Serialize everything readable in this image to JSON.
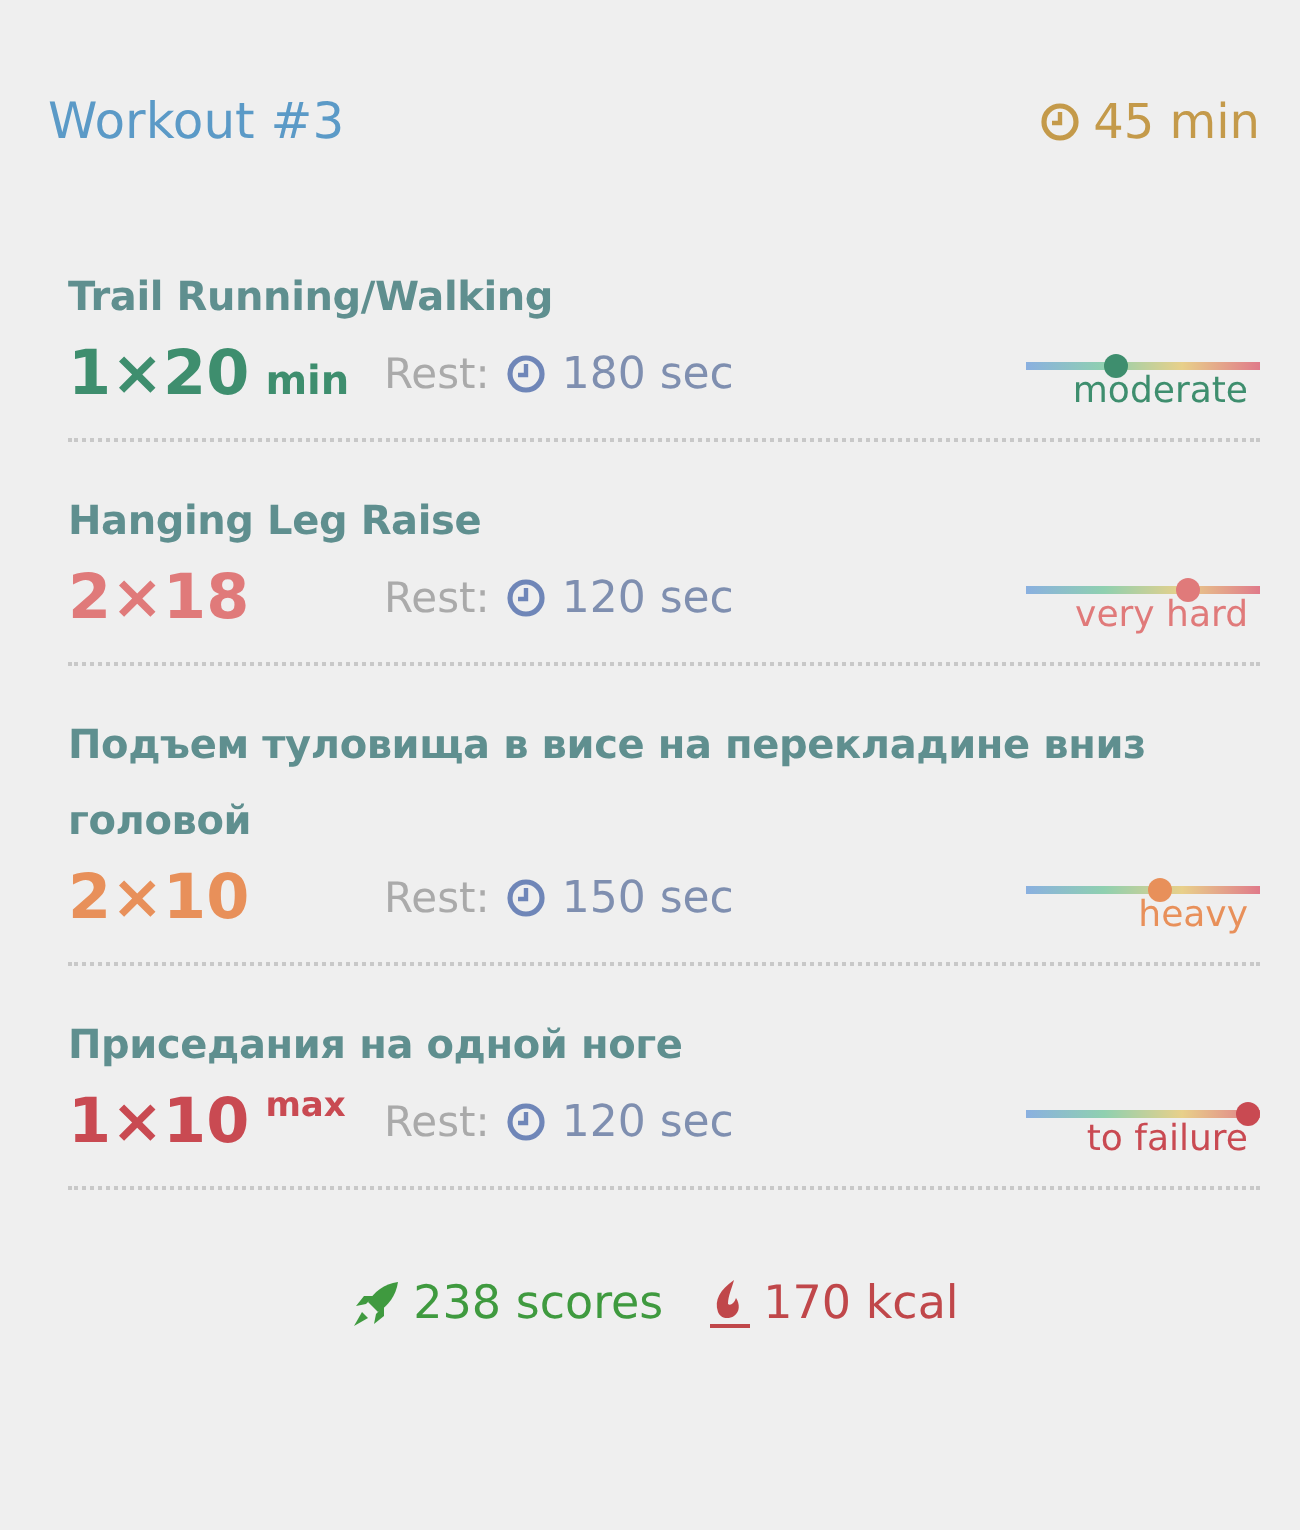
{
  "header": {
    "title": "Workout #3",
    "duration": "45 min"
  },
  "exercises": [
    {
      "name": "Trail Running/Walking",
      "sets": "1×20",
      "unit": "min",
      "unit_raised": false,
      "rest_label": "Rest:",
      "rest": "180 sec",
      "intensity": {
        "label": "moderate",
        "level": 0.44,
        "color": "#3e8e6e"
      }
    },
    {
      "name": "Hanging Leg Raise",
      "sets": "2×18",
      "rest_label": "Rest:",
      "rest": "120 sec",
      "intensity": {
        "label": "very hard",
        "level": 0.74,
        "color": "#e07a7a"
      }
    },
    {
      "name": "Подъем туловища в висе на перекладине вниз головой",
      "sets": "2×10",
      "rest_label": "Rest:",
      "rest": "150 sec",
      "intensity": {
        "label": "heavy",
        "level": 0.62,
        "color": "#e8905a"
      }
    },
    {
      "name": "Приседания на одной ноге",
      "sets": "1×10",
      "unit": "max",
      "unit_raised": true,
      "rest_label": "Rest:",
      "rest": "120 sec",
      "intensity": {
        "label": "to failure",
        "level": 1,
        "color": "#c94a52"
      }
    }
  ],
  "footer": {
    "scores": "238 scores",
    "calories": "170 kcal"
  }
}
